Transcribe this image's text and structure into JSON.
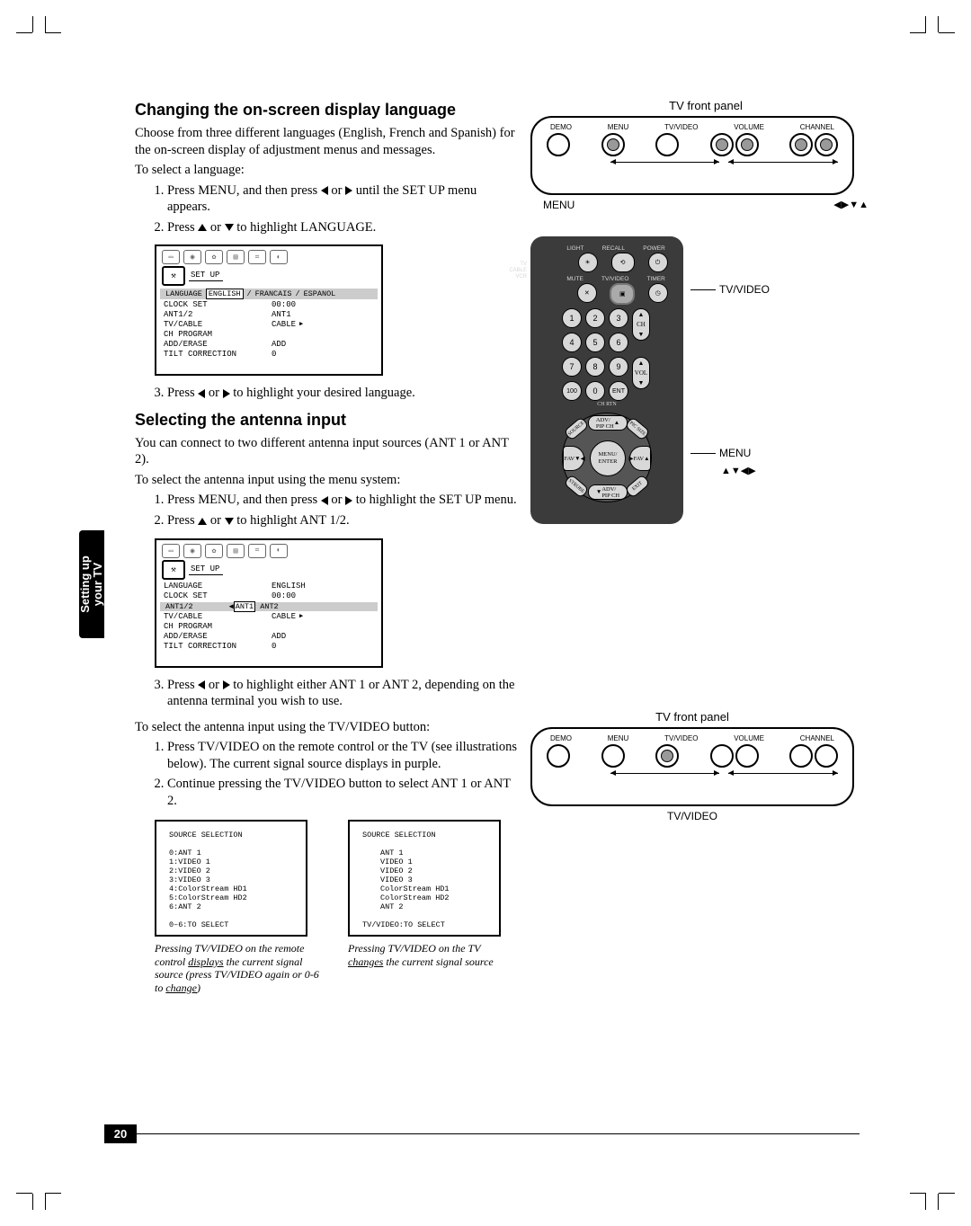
{
  "page_number": "20",
  "sidebar_tab": {
    "line1": "Setting up",
    "line2": "your TV"
  },
  "section1": {
    "heading": "Changing the on-screen display language",
    "intro": "Choose from three different languages (English, French and Spanish) for the on-screen display of adjustment menus and messages.",
    "lead": "To select a language:",
    "step1_a": "Press MENU, and then press ",
    "step1_b": " or ",
    "step1_c": " until the SET UP menu appears.",
    "step2_a": "Press ",
    "step2_b": " or ",
    "step2_c": " to highlight LANGUAGE.",
    "step3_a": "Press ",
    "step3_b": " or ",
    "step3_c": " to highlight your desired language."
  },
  "osd1": {
    "title": "SET UP",
    "langbar_label": "LANGUAGE",
    "lang_opts": [
      "ENGLISH",
      "FRANCAIS",
      "ESPANOL"
    ],
    "rows": [
      {
        "k": "CLOCK SET",
        "v": "00:00"
      },
      {
        "k": "ANT1/2",
        "v": "ANT1"
      },
      {
        "k": "TV/CABLE",
        "v": "CABLE"
      },
      {
        "k": "CH PROGRAM",
        "v": ""
      },
      {
        "k": "ADD/ERASE",
        "v": "ADD"
      },
      {
        "k": "TILT CORRECTION",
        "v": "0"
      }
    ]
  },
  "section2": {
    "heading": "Selecting the antenna input",
    "intro": "You can connect to two different antenna input sources (ANT 1 or ANT 2).",
    "lead_menu": "To select the antenna input using the menu system:",
    "s1_a": "Press MENU, and then press ",
    "s1_b": " or ",
    "s1_c": " to highlight the SET UP menu.",
    "s2_a": "Press ",
    "s2_b": " or ",
    "s2_c": " to highlight ANT 1/2.",
    "s3_a": "Press ",
    "s3_b": " or ",
    "s3_c": " to highlight either ANT 1 or ANT 2, depending on the antenna terminal you wish to use.",
    "lead_tv": "To select the antenna input using the TV/VIDEO button:",
    "t1": "Press TV/VIDEO on the remote control or the TV (see illustrations below). The current signal source displays in purple.",
    "t2": "Continue pressing the TV/VIDEO button to select ANT 1 or ANT 2."
  },
  "osd2": {
    "title": "SET UP",
    "rows_top": [
      {
        "k": "LANGUAGE",
        "v": "ENGLISH"
      },
      {
        "k": "CLOCK SET",
        "v": "00:00"
      }
    ],
    "antbar_label": "ANT1/2",
    "ant_opts": [
      "ANT1",
      "ANT2"
    ],
    "rows_bot": [
      {
        "k": "TV/CABLE",
        "v": "CABLE"
      },
      {
        "k": "CH PROGRAM",
        "v": ""
      },
      {
        "k": "ADD/ERASE",
        "v": "ADD"
      },
      {
        "k": "TILT CORRECTION",
        "v": "0"
      }
    ]
  },
  "srcbox1": {
    "title": "SOURCE SELECTION",
    "lines": [
      "0:ANT 1",
      "1:VIDEO 1",
      "2:VIDEO 2",
      "3:VIDEO 3",
      "4:ColorStream HD1",
      "5:ColorStream HD2",
      "6:ANT 2"
    ],
    "footer": "0–6:TO SELECT"
  },
  "srcbox2": {
    "title": "SOURCE SELECTION",
    "lines": [
      "ANT 1",
      "VIDEO 1",
      "VIDEO 2",
      "VIDEO 3",
      "ColorStream HD1",
      "ColorStream HD2",
      "ANT 2"
    ],
    "footer": "TV/VIDEO:TO SELECT"
  },
  "caption1_a": "Pressing TV/VIDEO on the remote control ",
  "caption1_u": "displays",
  "caption1_b": " the current signal source (press TV/VIDEO again or 0-6 to ",
  "caption1_u2": "change",
  "caption1_c": ")",
  "caption2_a": "Pressing TV/VIDEO on the TV ",
  "caption2_u": "changes",
  "caption2_b": " the current signal source",
  "frontpanel": {
    "title": "TV front panel",
    "labels": [
      "DEMO",
      "MENU",
      "TV/VIDEO",
      "VOLUME",
      "CHANNEL"
    ],
    "below_left": "MENU",
    "below_right": "◀▶▼▲",
    "below_tv": "TV/VIDEO"
  },
  "remote": {
    "toprow_labels": [
      "LIGHT",
      "RECALL",
      "POWER"
    ],
    "row2_labels": [
      "MUTE",
      "TV/VIDEO",
      "TIMER"
    ],
    "switch": [
      "TV",
      "CABLE",
      "VCR"
    ],
    "keypad": [
      "1",
      "2",
      "3",
      "4",
      "5",
      "6",
      "7",
      "8",
      "9",
      "100",
      "0",
      "ENT"
    ],
    "ch_label": "CH",
    "vol_label": "VOL",
    "chrtn": "CH RTN",
    "center": "MENU/\nENTER",
    "top_oval": "ADV/\nPIP CH",
    "bot_oval": "ADV/\nPIP CH",
    "fav_l": "FAV▼",
    "fav_r": "FAV▲",
    "diag": [
      "SOURCE",
      "PIC SIZE",
      "STROBE",
      "EXIT"
    ],
    "callout_tv": "TV/VIDEO",
    "callout_menu": "MENU",
    "callout_arrows": "▲▼◀▶"
  }
}
